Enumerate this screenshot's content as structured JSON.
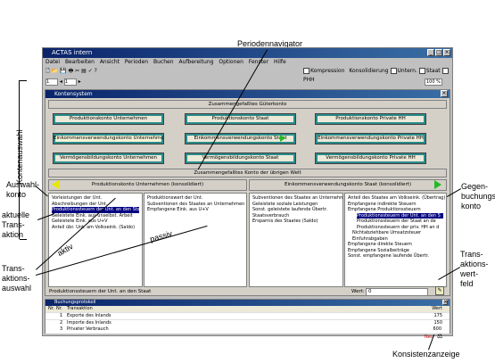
{
  "annotations": {
    "periodennavigator": "Periodennavigator",
    "kontenauswahl": "Kontenauswahl",
    "auswahlkonto": [
      "Auswahl-",
      "konto"
    ],
    "aktuelle_transaktion": [
      "aktuelle",
      "Trans-",
      "aktion"
    ],
    "transaktionsauswahl": [
      "Trans-",
      "aktions-",
      "auswahl"
    ],
    "aktiv": "aktiv",
    "passiv": "passiv",
    "gegenbuchungskonto": [
      "Gegen-",
      "buchungs-",
      "konto"
    ],
    "transaktionswertfeld": [
      "Trans-",
      "aktions-",
      "wert-",
      "feld"
    ],
    "konsistenzanzeige": "Konsistenzanzeige"
  },
  "app": {
    "title": "ACTAS intern",
    "menu": [
      "Datei",
      "Bearbeiten",
      "Ansicht",
      "Perioden",
      "Buchen",
      "Aufbereitung",
      "Optionen",
      "Fenster",
      "Hilfe"
    ],
    "toolbar_checks": [
      "Kompression",
      "Konsolidierung",
      "Untern.",
      "Staat",
      "PHH"
    ],
    "period_from": "1",
    "period_to": "1",
    "zoom": "100 %"
  },
  "konten": {
    "title": "Kontensystem",
    "guterkonto": "Zusammengefaßtes Güterkonto",
    "row1": [
      "Produktionskonto Unternehmen",
      "Produktionskonto Staat",
      "Produktionskonto Private HH"
    ],
    "row2": [
      "Einkommensverwendungskonto Unternehmen",
      "Einkommensverwendungskonto Staat",
      "Einkommensverwendungskonto Private HH"
    ],
    "row3": [
      "Vermögensbildungskonto Unternehmen",
      "Vermögensbildungskonto Staat",
      "Vermögensbildungskonto Private HH"
    ],
    "uebrige": "Zusammengefaßtes Konto der übrigen Welt",
    "left_account": "Produktionskonto Unternehmen (konsolidiert)",
    "right_account": "Einkommensverwendungskonto Staat (konsolidiert)",
    "left_debit": [
      "Vorleistungen der Unt.",
      "Abschreibungen der Unt.",
      "Produktionssteuern der Unt. an den Staat",
      "Geleistete Eink. aus unselbst. Arbeit",
      "Geleistete Eink. aus U+V",
      "Anteil übr. Unt. am Volkseink. (Saldo)"
    ],
    "left_credit": [
      "Produktionswert der Unt.",
      "Subventionen des Staates an Unternehmen",
      "Empfangene Eink. aus U+V"
    ],
    "right_debit": [
      "Subventionen des Staates an Unternehmen",
      "Geleistete soziale Leistungen",
      "Sonst. geleistete laufende Übertr.",
      "Staatsverbrauch",
      "Ersparnis des Staates (Saldo)"
    ],
    "right_credit": [
      "Anteil des Staates am Volkseink. (Übertrag)",
      "Empfangene indirekte Steuern",
      "Empfangene Produktionssteuern",
      "Produktionssteuern der Unt. an den S",
      "Produktionssteuern der Staat an de",
      "Produktionssteuern der priv. HH an d",
      "Nichtabziehbare Umsatzsteuer",
      "Einfuhrabgaben",
      "Empfangene direkte Steuern",
      "Empfangene Sozialbeiträge",
      "Sonst. empfangene laufende Übertr."
    ],
    "status_text": "Produktionssteuern der Unt. an den Staat",
    "wert_label": "Wert:",
    "wert_value": "0"
  },
  "protokoll": {
    "title": "Buchungsprotokoll",
    "headers": [
      "Nr.",
      "Nr.",
      "Transaktion",
      "Wert"
    ],
    "rows": [
      {
        "nr": "1",
        "text": "Exporte des Inlands",
        "wert": "175"
      },
      {
        "nr": "2",
        "text": "Importe des Inlands",
        "wert": "150"
      },
      {
        "nr": "3",
        "text": "Privater Verbrauch",
        "wert": "600"
      }
    ],
    "status": "Neu"
  }
}
